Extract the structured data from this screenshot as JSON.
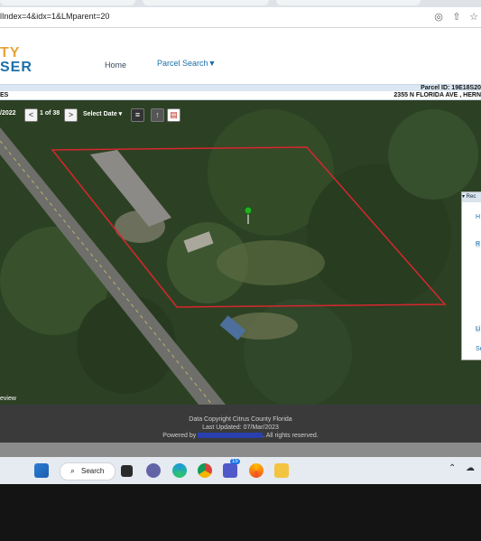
{
  "browser": {
    "url": "lIndex=4&idx=1&LMparent=20"
  },
  "site": {
    "logo_line1": "TY",
    "logo_line2": "SER",
    "nav_home": "Home",
    "nav_parcel_search": "Parcel Search▼"
  },
  "parcel": {
    "parcel_id": "Parcel ID: 19E18S20",
    "address": "2355 N FLORIDA AVE , HERN",
    "left_label": "ES"
  },
  "map_toolbar": {
    "date_fragment": "/2022",
    "page_indicator": "1 of 38",
    "select_date": "Select Date ▾",
    "prev": "<",
    "next": ">"
  },
  "map": {
    "review_label": "eview",
    "side_panel_header": "▾ Rec",
    "side_panel_items": [
      "H",
      "R",
      "Li",
      "Se"
    ]
  },
  "footer": {
    "line1": "Data Copyright Citrus County Florida",
    "last_updated_label": "Last Updated:",
    "last_updated_value": "07/Mar/2023",
    "powered_by": "Powered by",
    "rights": ". All rights reserved."
  },
  "taskbar": {
    "search_label": "Search",
    "teams_badge": "15"
  },
  "colors": {
    "parcel_outline": "#d8262e",
    "pin": "#22b022",
    "logo_orange": "#e8a33a",
    "logo_blue": "#1d6fa8"
  }
}
